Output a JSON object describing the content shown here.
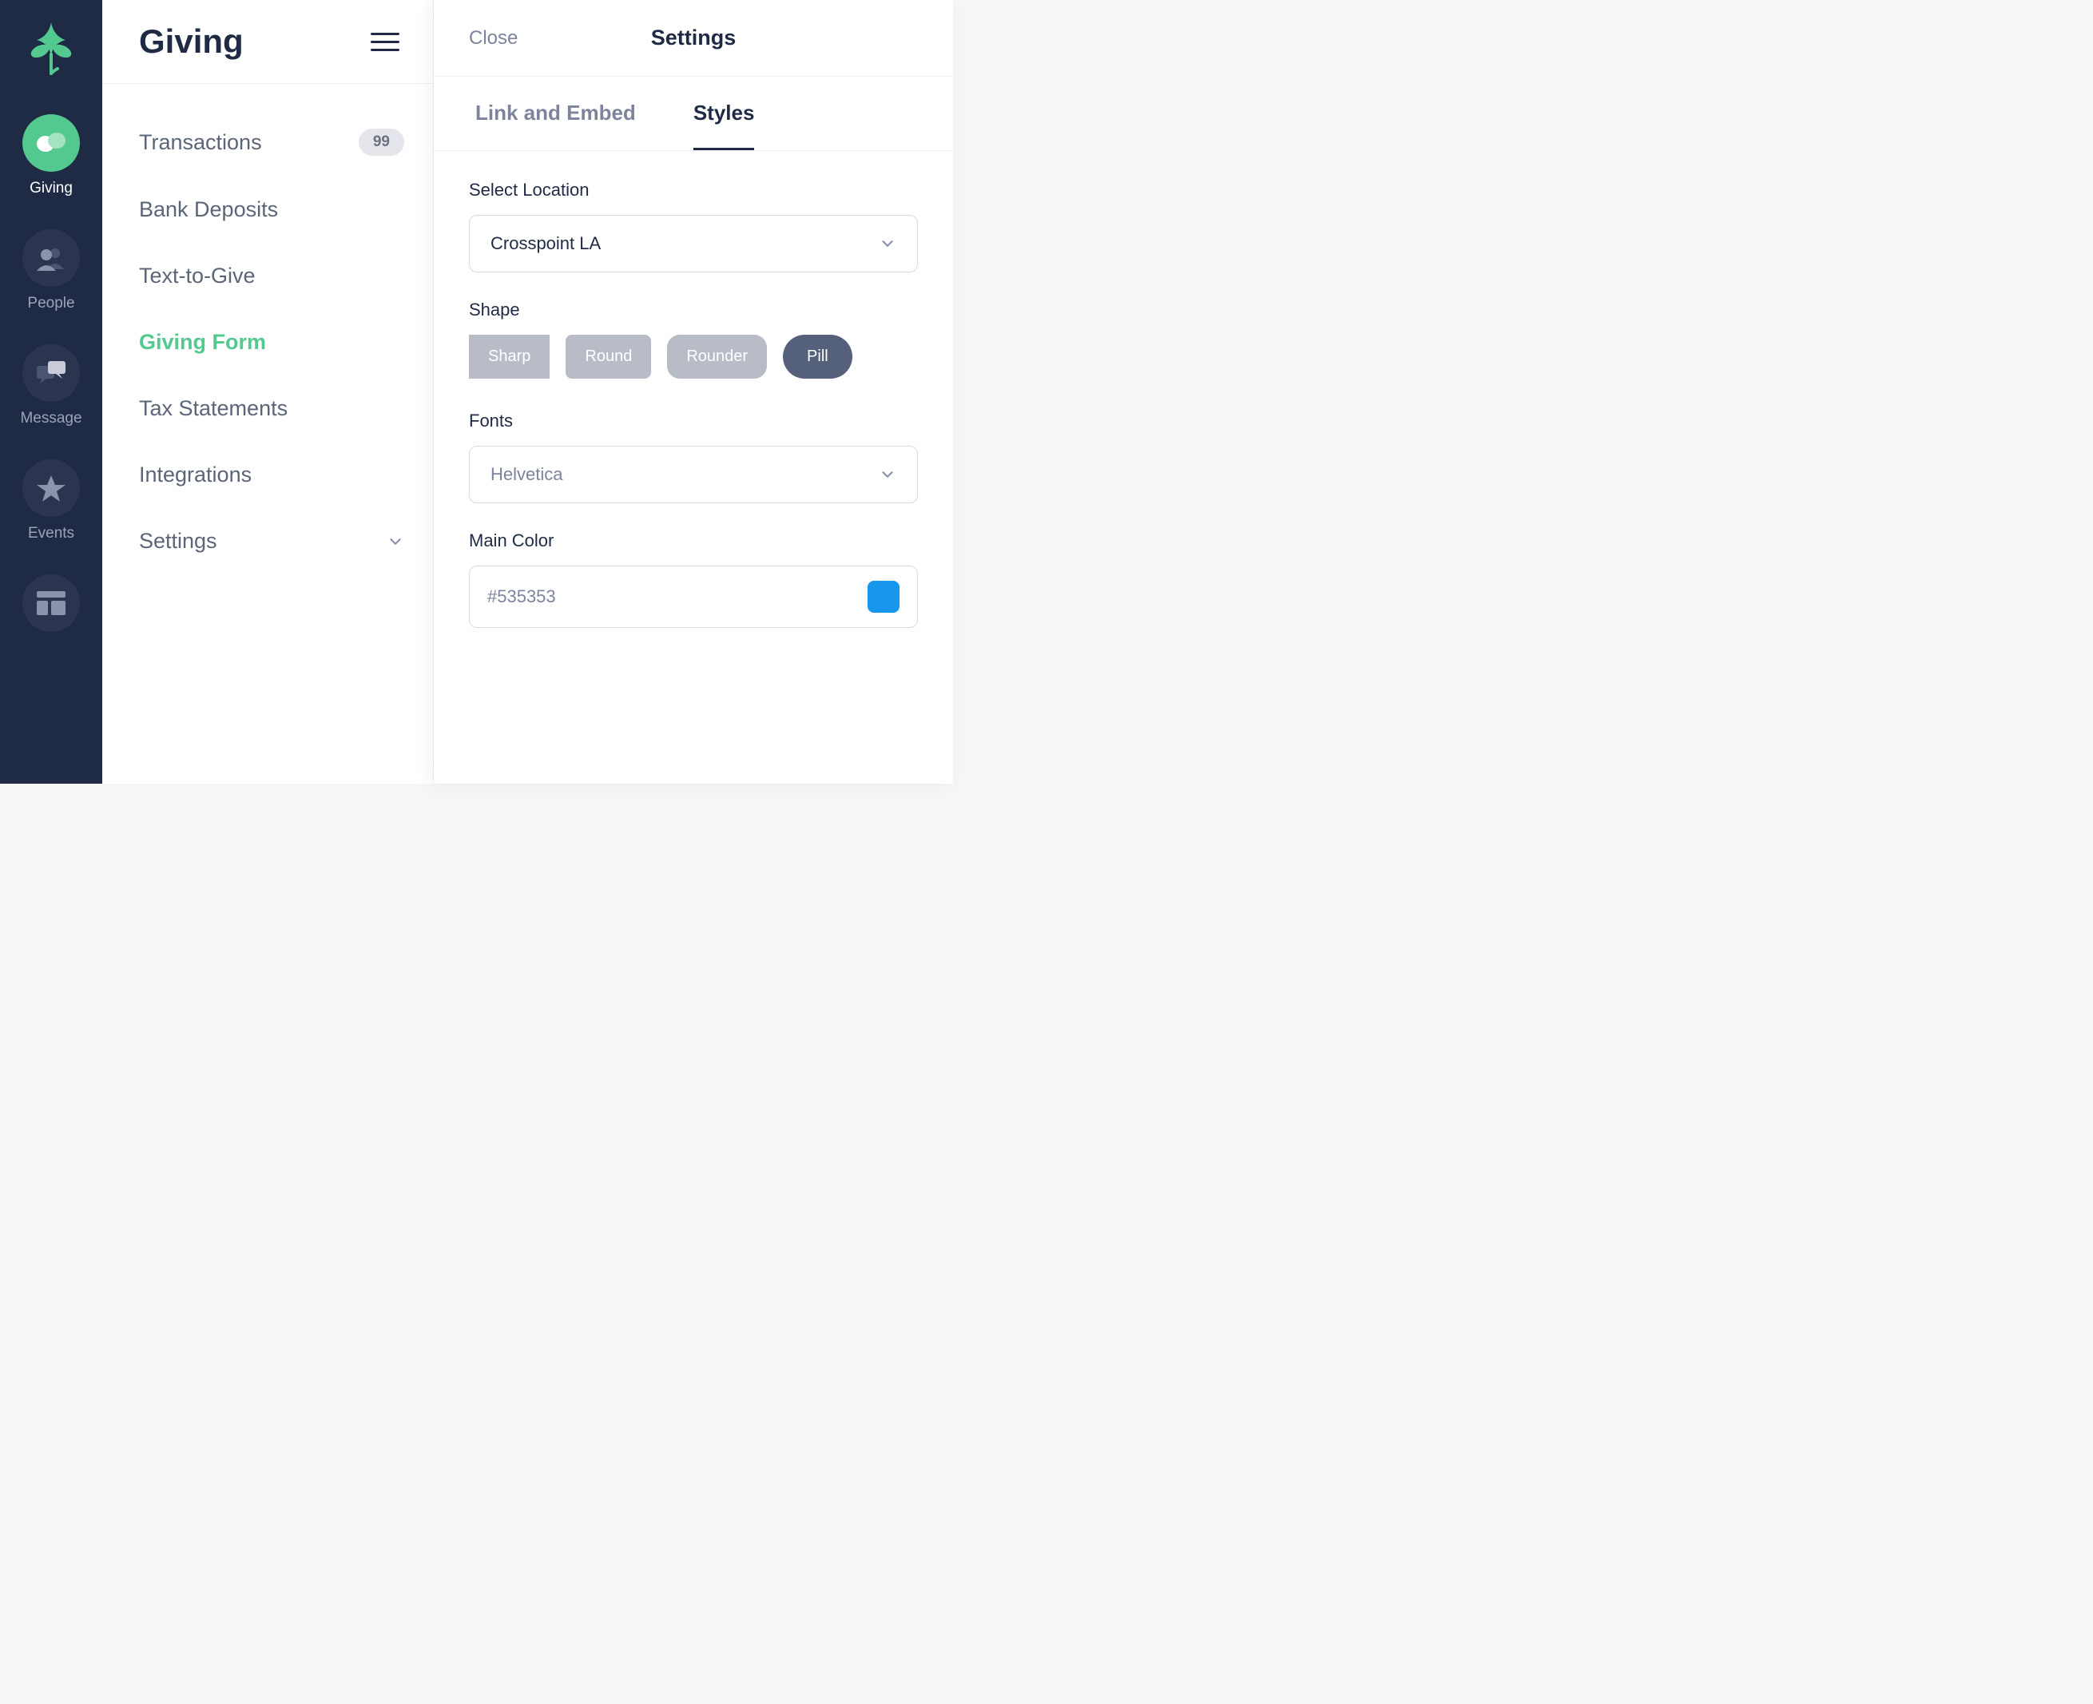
{
  "rail": {
    "items": [
      {
        "label": "Giving"
      },
      {
        "label": "People"
      },
      {
        "label": "Message"
      },
      {
        "label": "Events"
      }
    ]
  },
  "sub": {
    "title": "Giving",
    "items": [
      {
        "label": "Transactions",
        "badge": "99"
      },
      {
        "label": "Bank Deposits"
      },
      {
        "label": "Text-to-Give"
      },
      {
        "label": "Giving Form"
      },
      {
        "label": "Tax Statements"
      },
      {
        "label": "Integrations"
      },
      {
        "label": "Settings"
      }
    ]
  },
  "settings": {
    "close": "Close",
    "title": "Settings",
    "tabs": {
      "link": "Link and Embed",
      "styles": "Styles"
    },
    "location_label": "Select Location",
    "location_value": "Crosspoint LA",
    "shape_label": "Shape",
    "shapes": {
      "sharp": "Sharp",
      "round": "Round",
      "rounder": "Rounder",
      "pill": "Pill"
    },
    "fonts_label": "Fonts",
    "fonts_value": "Helvetica",
    "color_label": "Main Color",
    "color_value": "#535353",
    "color_swatch": "#1896ee"
  }
}
